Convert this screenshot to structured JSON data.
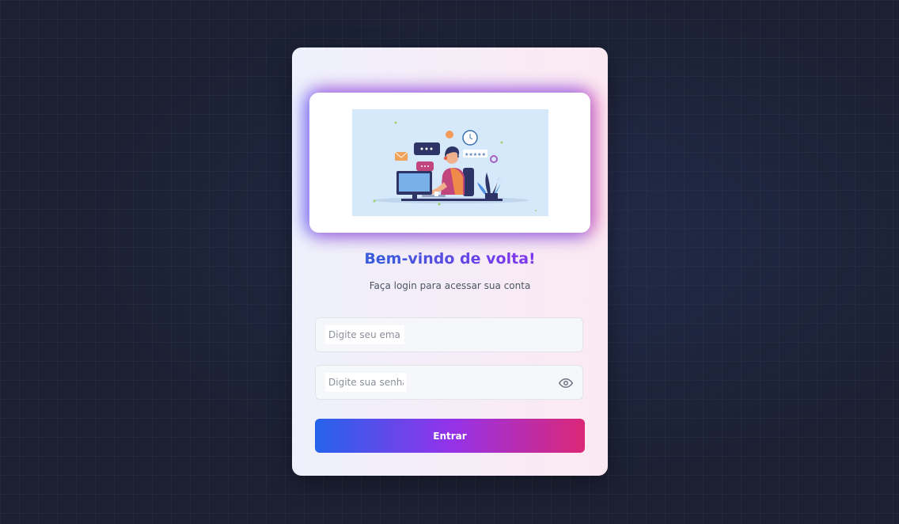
{
  "login": {
    "title": "Bem-vindo de volta!",
    "subtitle": "Faça login para acessar sua conta",
    "email": {
      "placeholder": "Digite seu email",
      "value": ""
    },
    "password": {
      "placeholder": "Digite sua senha",
      "value": "",
      "toggle_icon": "eye-icon"
    },
    "submit_label": "Entrar",
    "illustration": "customer-support-illustration"
  },
  "colors": {
    "background": "#1b2033",
    "gradient_start": "#2563eb",
    "gradient_mid": "#9333ea",
    "gradient_end": "#db2777",
    "title_blue": "#3b5bdb",
    "title_purple": "#7c3aed"
  }
}
